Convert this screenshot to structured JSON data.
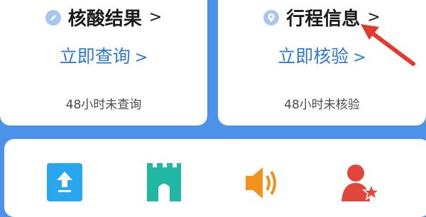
{
  "cards": {
    "left": {
      "title": "核酸结果",
      "title_icon": "pen-icon",
      "action": "立即查询",
      "note": "48小时未查询"
    },
    "right": {
      "title": "行程信息",
      "title_icon": "location-pin-icon",
      "action": "立即核验",
      "note": "48小时未核验"
    }
  },
  "chevron": ">",
  "colors": {
    "background": "#4c92ea",
    "action_text": "#2f78d4",
    "annotation_arrow": "#e23b2e"
  },
  "bottom_tiles": [
    {
      "icon": "upload-icon"
    },
    {
      "icon": "castle-gate-icon"
    },
    {
      "icon": "speaker-icon"
    },
    {
      "icon": "user-star-icon"
    }
  ]
}
